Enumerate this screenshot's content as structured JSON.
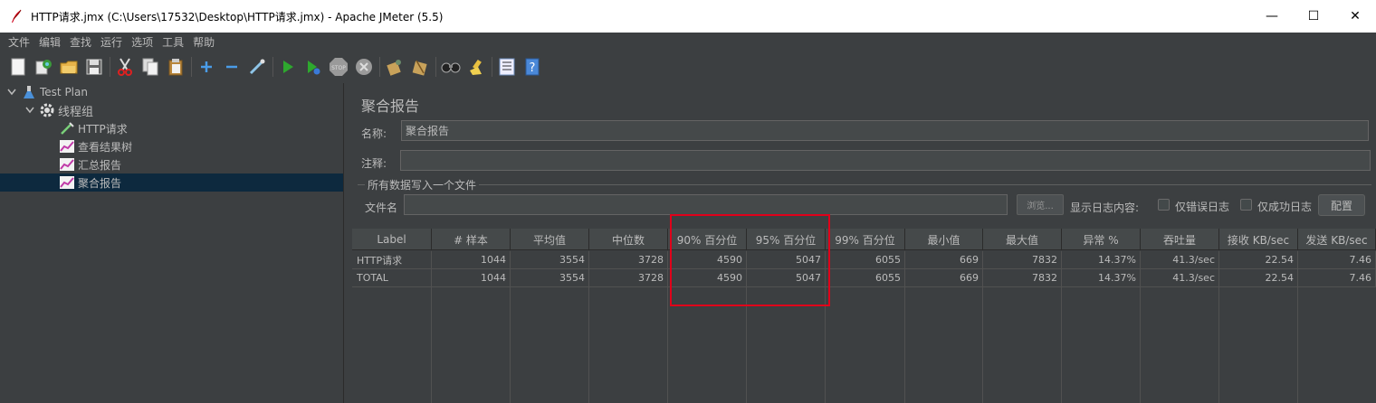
{
  "window": {
    "title": "HTTP请求.jmx (C:\\Users\\17532\\Desktop\\HTTP请求.jmx) - Apache JMeter (5.5)",
    "minimize": "—",
    "maximize": "☐",
    "close": "✕"
  },
  "menu": [
    "文件",
    "编辑",
    "查找",
    "运行",
    "选项",
    "工具",
    "帮助"
  ],
  "toolbar": {
    "icons": [
      "new-icon",
      "templates-icon",
      "open-icon",
      "save-icon",
      "cut-icon",
      "copy-icon",
      "paste-icon",
      "expand-icon",
      "collapse-icon",
      "toggle-icon",
      "start-icon",
      "start-no-pause-icon",
      "stop-icon",
      "shutdown-icon",
      "clear-icon",
      "clear-all-icon",
      "search-icon",
      "reset-search-icon",
      "function-helper-icon",
      "help-icon"
    ]
  },
  "tree": {
    "items": [
      {
        "label": "Test Plan",
        "icon": "flask-icon",
        "expanded": true
      },
      {
        "label": "线程组",
        "icon": "gear-icon",
        "expanded": true
      },
      {
        "label": "HTTP请求",
        "icon": "pipette-icon"
      },
      {
        "label": "查看结果树",
        "icon": "graph-icon"
      },
      {
        "label": "汇总报告",
        "icon": "graph-icon"
      },
      {
        "label": "聚合报告",
        "icon": "graph-icon",
        "selected": true
      }
    ]
  },
  "panel": {
    "title": "聚合报告",
    "name_label": "名称:",
    "name_value": "聚合报告",
    "comment_label": "注释:",
    "comment_value": "",
    "file_group_title": "所有数据写入一个文件",
    "filename_label": "文件名",
    "filename_value": "",
    "browse_label": "浏览...",
    "log_label": "显示日志内容:",
    "errors_only_label": "仅错误日志",
    "success_only_label": "仅成功日志",
    "config_label": "配置"
  },
  "table": {
    "headers": [
      "Label",
      "# 样本",
      "平均值",
      "中位数",
      "90% 百分位",
      "95% 百分位",
      "99% 百分位",
      "最小值",
      "最大值",
      "异常 %",
      "吞吐量",
      "接收 KB/sec",
      "发送 KB/sec"
    ],
    "rows": [
      [
        "HTTP请求",
        "1044",
        "3554",
        "3728",
        "4590",
        "5047",
        "6055",
        "669",
        "7832",
        "14.37%",
        "41.3/sec",
        "22.54",
        "7.46"
      ],
      [
        "TOTAL",
        "1044",
        "3554",
        "3728",
        "4590",
        "5047",
        "6055",
        "669",
        "7832",
        "14.37%",
        "41.3/sec",
        "22.54",
        "7.46"
      ]
    ]
  },
  "colors": {
    "background": "#3c3f41",
    "selected_row": "#0d293e",
    "highlight": "#e0001a",
    "text": "#bbbbbb"
  }
}
